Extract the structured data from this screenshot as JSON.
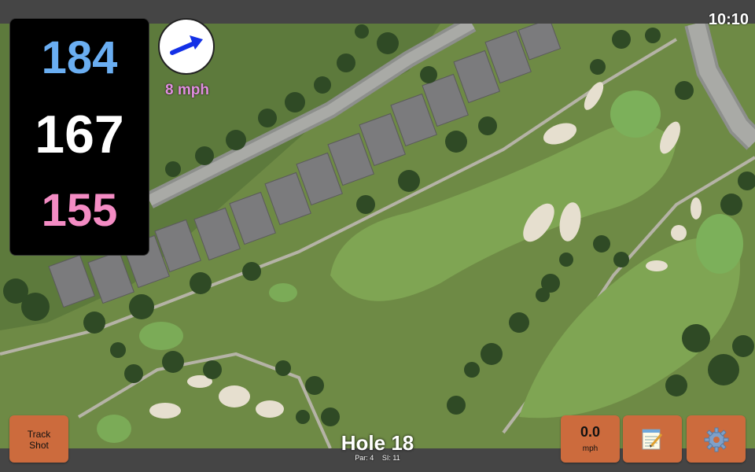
{
  "clock": "10:10",
  "distances": {
    "back": "184",
    "middle": "167",
    "front": "155"
  },
  "distance_colors": {
    "back": "#6aaef2",
    "middle": "#ffffff",
    "front": "#f48cc4"
  },
  "wind": {
    "speed_label": "8 mph",
    "direction_icon": "wind-arrow-icon",
    "color": "#e18ee0"
  },
  "track_shot": {
    "line1": "Track",
    "line2": "Shot"
  },
  "wind_button": {
    "value": "0.0",
    "unit": "mph"
  },
  "notes_button": {
    "icon": "notepad-icon"
  },
  "settings_button": {
    "icon": "gear-icon"
  },
  "hole": {
    "title": "Hole 18",
    "par": "Par: 4",
    "si": "SI: 11"
  },
  "colors": {
    "button": "#cc6b3d",
    "bar": "#454545",
    "panel": "#000000"
  }
}
